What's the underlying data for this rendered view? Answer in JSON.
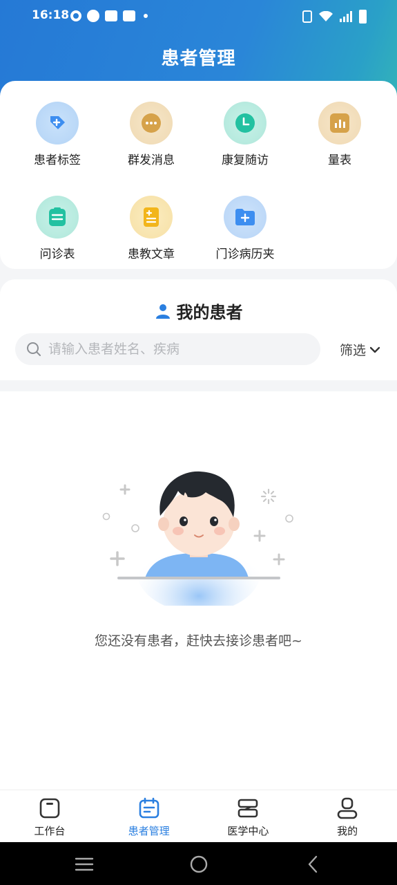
{
  "status_bar": {
    "time": "16:18"
  },
  "header": {
    "title": "患者管理"
  },
  "quick_menu": [
    {
      "label": "患者标签",
      "icon": "tag-icon"
    },
    {
      "label": "群发消息",
      "icon": "chat-dots-icon"
    },
    {
      "label": "康复随访",
      "icon": "clock-icon"
    },
    {
      "label": "量表",
      "icon": "chart-icon"
    },
    {
      "label": "问诊表",
      "icon": "clipboard-icon"
    },
    {
      "label": "患教文章",
      "icon": "document-icon"
    },
    {
      "label": "门诊病历夹",
      "icon": "folder-icon"
    }
  ],
  "patients": {
    "title": "我的患者",
    "search_placeholder": "请输入患者姓名、疾病",
    "filter_label": "筛选",
    "empty_text": "您还没有患者，赶快去接诊患者吧~"
  },
  "tabs": [
    {
      "label": "工作台",
      "icon": "workbench-icon",
      "active": false
    },
    {
      "label": "患者管理",
      "icon": "patient-manage-icon",
      "active": true
    },
    {
      "label": "医学中心",
      "icon": "medical-center-icon",
      "active": false
    },
    {
      "label": "我的",
      "icon": "profile-icon",
      "active": false
    }
  ],
  "colors": {
    "primary": "#2a7fe0",
    "header_start": "#2579d6",
    "header_end": "#33b3b9"
  }
}
